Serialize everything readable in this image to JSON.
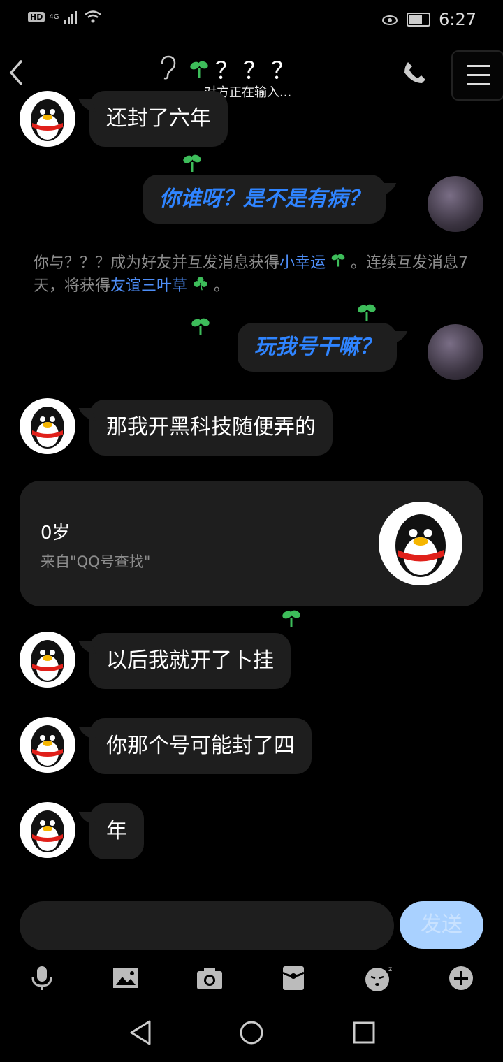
{
  "status": {
    "network": "4G",
    "time": "6:27",
    "hd": "HD"
  },
  "header": {
    "title": "？？？",
    "typing": "对方正在输入..."
  },
  "messages": {
    "m1": "还封了六年",
    "m2": "你谁呀？是不是有病？",
    "m3": "玩我号干嘛？",
    "m4": "那我开黑科技随便弄的",
    "m5": "以后我就开了卜挂",
    "m6": "你那个号可能封了四",
    "m7": "年"
  },
  "system": {
    "p1": "你与？？？成为好友并互发消息获得",
    "hl1": "小幸运",
    "p2": "。连续互发消息7天，将获得",
    "hl2": "友谊三叶草",
    "p3": "。"
  },
  "card": {
    "age": "0岁",
    "source": "来自\"QQ号查找\""
  },
  "composer": {
    "send": "发送"
  },
  "colors": {
    "accent": "#2f84ff",
    "bubble": "#1e1e1e",
    "send_bg": "#a9d1ff"
  }
}
